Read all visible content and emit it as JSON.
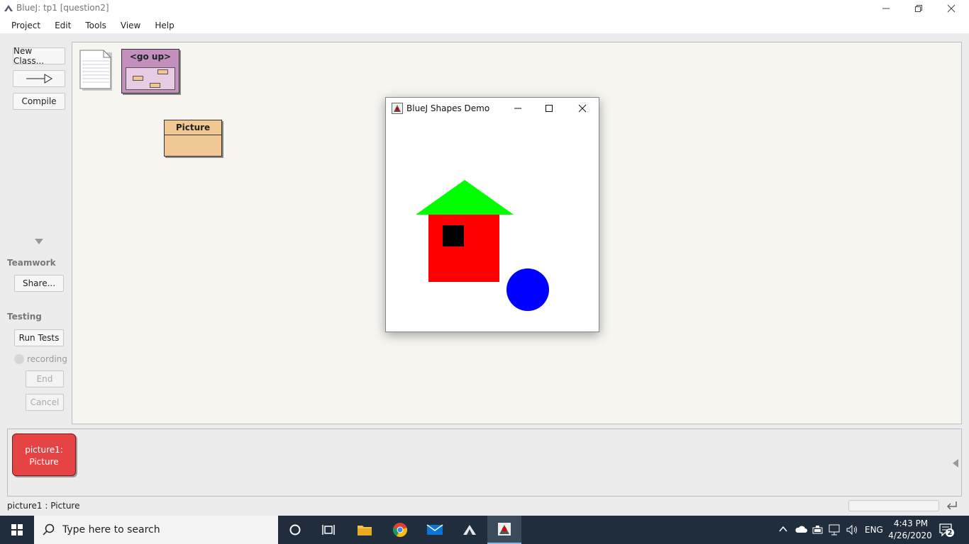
{
  "window": {
    "title": "BlueJ:  tp1  [question2]"
  },
  "menu": [
    "Project",
    "Edit",
    "Tools",
    "View",
    "Help"
  ],
  "sidebar": {
    "new_class": "New Class...",
    "compile": "Compile",
    "teamwork_label": "Teamwork",
    "share": "Share...",
    "testing_label": "Testing",
    "run_tests": "Run Tests",
    "recording": "recording",
    "end": "End",
    "cancel": "Cancel"
  },
  "diagram": {
    "go_up_label": "<go up>",
    "picture_class": "Picture"
  },
  "object_bench": {
    "object_name": "picture1:",
    "object_type": "Picture"
  },
  "status_bar": {
    "text": "picture1 : Picture"
  },
  "shapes_window": {
    "title": "BlueJ Shapes Demo",
    "colors": {
      "roof": "#00ff00",
      "wall": "#ff0000",
      "window": "#000000",
      "sun": "#0000ff"
    }
  },
  "taskbar": {
    "search_placeholder": "Type here to search",
    "language": "ENG",
    "time": "4:43 PM",
    "date": "4/26/2020",
    "notification_count": "2"
  }
}
